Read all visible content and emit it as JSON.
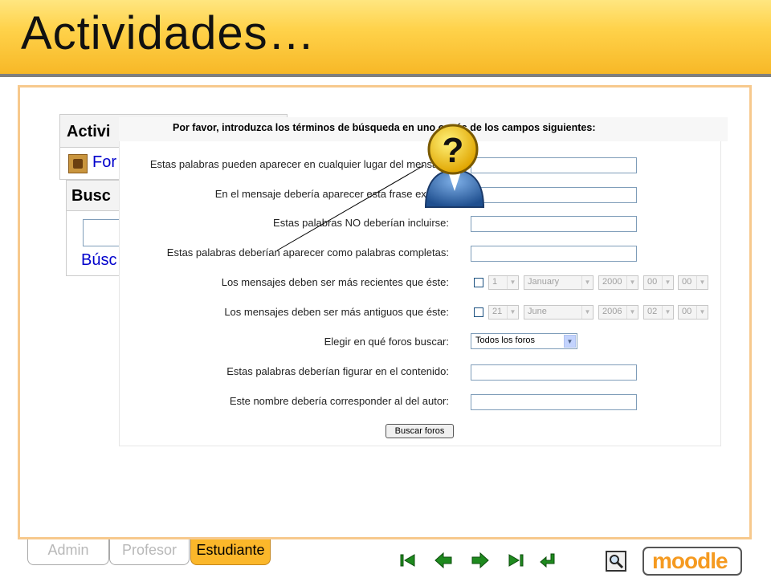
{
  "slide": {
    "title": "Actividades…"
  },
  "moodle_block": {
    "activities_title": "Activi",
    "forum_link": "For",
    "search_title": "Busc",
    "search_link": "Búsc"
  },
  "form": {
    "intro": "Por favor, introduzca los términos de búsqueda en uno o más de los campos siguientes:",
    "fields": [
      {
        "label": "Estas palabras pueden aparecer en cualquier lugar del mensaje:",
        "value": ""
      },
      {
        "label": "En el mensaje debería aparecer esta frase exacta:",
        "value": ""
      },
      {
        "label": "Estas palabras NO deberían incluirse:",
        "value": ""
      },
      {
        "label": "Estas palabras deberían aparecer como palabras completas:",
        "value": ""
      }
    ],
    "date_from": {
      "label": "Los mensajes deben ser más recientes que éste:",
      "day": "1",
      "month": "January",
      "year": "2000",
      "hour": "00",
      "minute": "00"
    },
    "date_to": {
      "label": "Los mensajes deben ser más antiguos que éste:",
      "day": "21",
      "month": "June",
      "year": "2006",
      "hour": "02",
      "minute": "00"
    },
    "forum_select": {
      "label": "Elegir en qué foros buscar:",
      "value": "Todos los foros"
    },
    "content": {
      "label": "Estas palabras deberían figurar en el contenido:",
      "value": ""
    },
    "author": {
      "label": "Este nombre debería corresponder al del autor:",
      "value": ""
    },
    "submit": "Buscar foros"
  },
  "tabs": [
    {
      "label": "Admin",
      "active": false
    },
    {
      "label": "Profesor",
      "active": false
    },
    {
      "label": "Estudiante",
      "active": true
    }
  ],
  "navigation": {
    "icons": [
      "first-slide-icon",
      "previous-slide-icon",
      "next-slide-icon",
      "last-slide-icon",
      "return-icon"
    ],
    "search_icon": "magnifier-icon",
    "logo_text": "moodle"
  },
  "colors": {
    "header_orange": "#f7b827",
    "frame_border": "#f7c98d",
    "tab_active": "#fbb72a",
    "moodle_orange": "#f59a20",
    "link_blue": "#0000cc",
    "nav_green": "#1e8a1e"
  }
}
